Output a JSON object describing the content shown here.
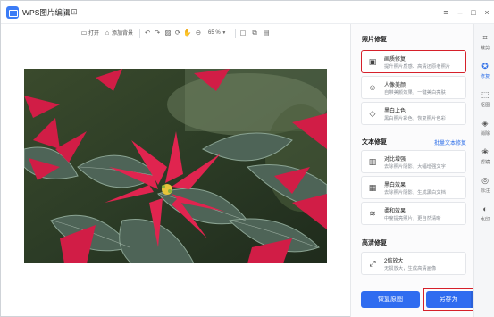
{
  "app": {
    "title": "WPS图片编辑"
  },
  "toolbar": {
    "open": "打开",
    "add_background": "添加背景",
    "zoom": "65 %"
  },
  "panel": {
    "photo_repair": {
      "title": "照片修复",
      "items": [
        {
          "name": "画质修复",
          "desc": "提升照片质感、高清还原老照片",
          "icon": "image-icon"
        },
        {
          "name": "人像美颜",
          "desc": "自带美颜效果，一键美白亮肤",
          "icon": "portrait-icon"
        },
        {
          "name": "黑白上色",
          "desc": "黑白照片彩色，恢复照片色彩",
          "icon": "color-icon"
        }
      ]
    },
    "text_repair": {
      "title": "文本修复",
      "link": "批量文本修复",
      "items": [
        {
          "name": "对比增强",
          "desc": "去除照片阴影，大幅增强文字",
          "icon": "contrast-icon"
        },
        {
          "name": "黑白效果",
          "desc": "去除照片阴影，生成黑白文档",
          "icon": "bw-icon"
        },
        {
          "name": "柔和效果",
          "desc": "中度提亮照片，更自然清晰",
          "icon": "soft-icon"
        }
      ]
    },
    "hd_repair": {
      "title": "高清修复",
      "items": [
        {
          "name": "2倍放大",
          "desc": "无损放大，生成高清画像",
          "icon": "expand-icon"
        }
      ]
    },
    "buttons": {
      "reset": "恢复原图",
      "save_as": "另存为"
    }
  },
  "rail": [
    {
      "label": "裁剪",
      "icon": "crop-icon"
    },
    {
      "label": "修复",
      "icon": "repair-icon"
    },
    {
      "label": "抠图",
      "icon": "cutout-icon"
    },
    {
      "label": "消除",
      "icon": "eraser-icon"
    },
    {
      "label": "滤镜",
      "icon": "filter-icon"
    },
    {
      "label": "标注",
      "icon": "annotate-icon"
    },
    {
      "label": "水印",
      "icon": "watermark-icon"
    }
  ],
  "colors": {
    "accent": "#2f6cf0",
    "highlight": "#d6202a"
  }
}
